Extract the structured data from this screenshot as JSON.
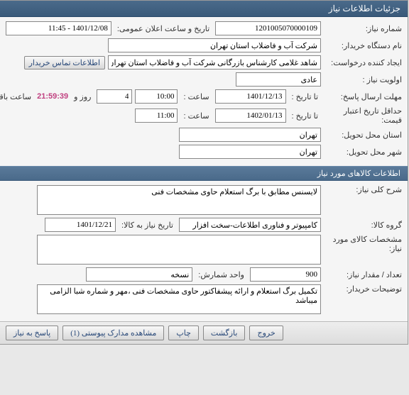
{
  "window_title": "جزئیات اطلاعات نیاز",
  "need": {
    "number_label": "شماره نیاز:",
    "number": "1201005070000109",
    "announce_label": "تاریخ و ساعت اعلان عمومی:",
    "announce_value": "1401/12/08 - 11:45",
    "buyer_label": "نام دستگاه خریدار:",
    "buyer": "شركت آب و فاضلاب استان تهران",
    "creator_label": "ایجاد کننده درخواست:",
    "creator": "شاهد غلامی کارشناس بازرگانی شركت آب و فاضلاب استان تهران",
    "contact_btn": "اطلاعات تماس خریدار",
    "priority_label": "اولویت نیاز :",
    "priority": "عادی",
    "reply_deadline_label": "مهلت ارسال پاسخ:",
    "to_date_label": "تا تاریخ :",
    "reply_date": "1401/12/13",
    "time_label": "ساعت :",
    "reply_time": "10:00",
    "days": "4",
    "days_label": "روز و",
    "countdown": "21:59:39",
    "remain_label": "ساعت باقی مانده",
    "validity_label": "حداقل تاریخ اعتبار قیمت:",
    "validity_date": "1402/01/13",
    "validity_time": "11:00",
    "province_label": "استان محل تحویل:",
    "province": "تهران",
    "city_label": "شهر محل تحویل:",
    "city": "تهران"
  },
  "section2_title": "اطلاعات کالاهای مورد نیاز",
  "goods": {
    "desc_label": "شرح کلی نیاز:",
    "desc": "لایسنس مطابق با برگ استعلام حاوی مشخصات فنی",
    "group_label": "گروه کالا:",
    "group": "کامپیوتر و فناوری اطلاعات-سخت افزار",
    "need_date_label": "تاریخ نیاز به کالا:",
    "need_date": "1401/12/21",
    "spec_label": "مشخصات کالای مورد نیاز:",
    "spec": "",
    "qty_label": "تعداد / مقدار نیاز:",
    "qty": "900",
    "unit_label": "واحد شمارش:",
    "unit": "نسخه",
    "notes_label": "توضیحات خریدار:",
    "notes": "تکمیل برگ استعلام و ارائه پیشفاکتور حاوی مشخصات فنی ،مهر و شماره شبا الزامی میباشد"
  },
  "toolbar": {
    "reply": "پاسخ به نیاز",
    "attachments": "مشاهده مدارک پیوستی (1)",
    "print": "چاپ",
    "back": "بازگشت",
    "exit": "خروج"
  }
}
